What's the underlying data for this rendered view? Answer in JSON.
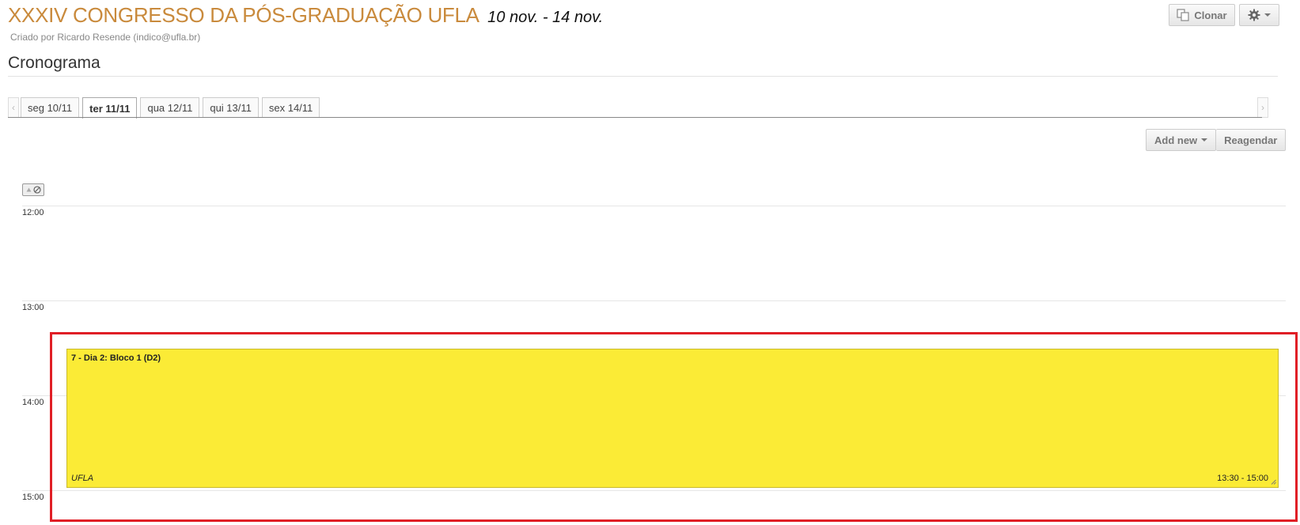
{
  "header": {
    "title": "XXXIV CONGRESSO DA PÓS-GRADUAÇÃO UFLA",
    "dates": "10 nov. - 14 nov.",
    "creator": "Criado por Ricardo Resende (indico@ufla.br)",
    "clone_label": "Clonar",
    "settings_icon": "gear-icon"
  },
  "section": {
    "title": "Cronograma"
  },
  "tabs": [
    {
      "label": "seg 10/11",
      "active": false
    },
    {
      "label": "ter 11/11",
      "active": true
    },
    {
      "label": "qua 12/11",
      "active": false
    },
    {
      "label": "qui 13/11",
      "active": false
    },
    {
      "label": "sex 14/11",
      "active": false
    }
  ],
  "toolbar": {
    "add_new_label": "Add new",
    "reschedule_label": "Reagendar"
  },
  "timetable": {
    "hours": [
      "12:00",
      "13:00",
      "14:00",
      "15:00"
    ],
    "event": {
      "title": "7 - Dia 2: Bloco 1 (D2)",
      "room": "UFLA",
      "time": "13:30 - 15:00",
      "color": "#fbeb36"
    }
  },
  "colors": {
    "title": "#c98a3c",
    "highlight": "#e01f26"
  }
}
